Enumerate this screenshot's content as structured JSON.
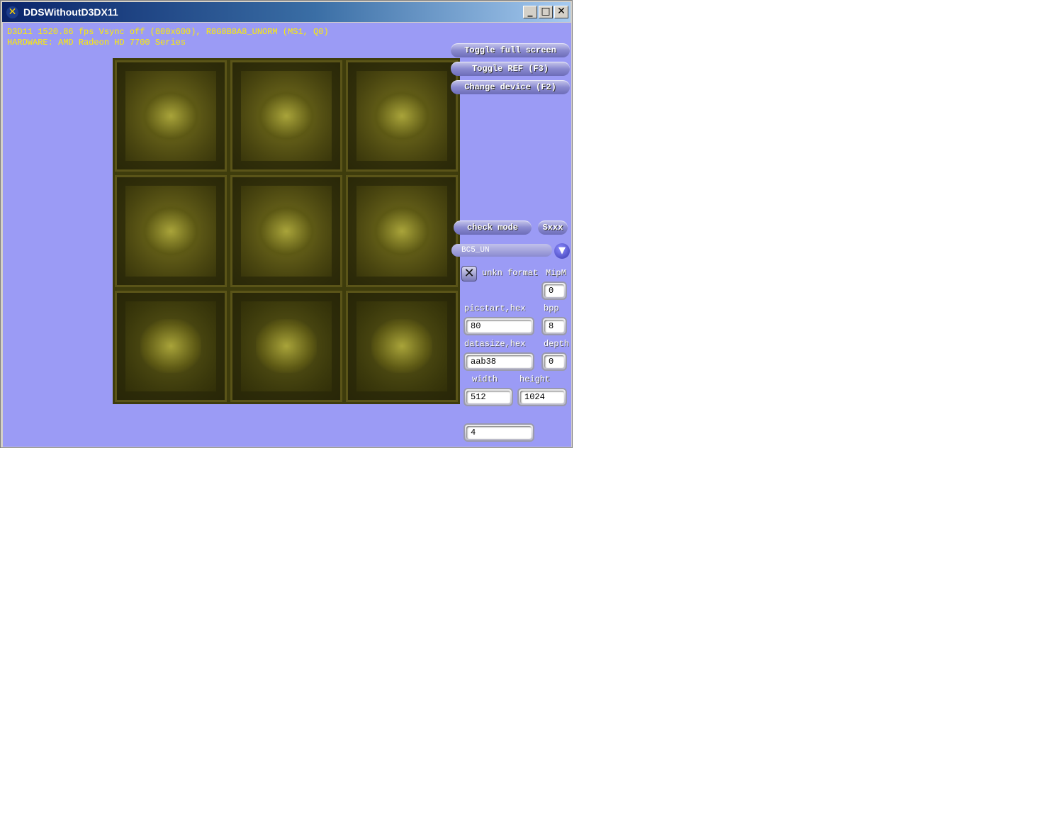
{
  "window": {
    "title": "DDSWithoutD3DX11",
    "minimize_glyph": "_",
    "maximize_glyph": "□",
    "close_glyph": "✕",
    "app_icon_glyph": "✕"
  },
  "stats": {
    "line1": "D3D11 1520.86 fps Vsync off (800x600), R8G8B8A8_UNORM (MS1, Q0)",
    "line2": "HARDWARE: AMD Radeon HD 7700 Series",
    "color": "#ffee00"
  },
  "buttons": {
    "toggle_full_screen": "Toggle full screen",
    "toggle_ref": "Toggle REF (F3)",
    "change_device": "Change device (F2)",
    "check_mode": "check mode",
    "sxxx": "Sxxx"
  },
  "format_combo": {
    "selected": "BC5_UN",
    "arrow_glyph": "▼"
  },
  "checkbox": {
    "checked": true,
    "glyph": "✕",
    "label": "unkn format"
  },
  "labels": {
    "mipm": "MipM",
    "picstart_hex": "picstart,hex",
    "bpp": "bpp",
    "datasize_hex": "datasize,hex",
    "depth": "depth",
    "width": "width",
    "height": "height"
  },
  "fields": {
    "mipm": "0",
    "picstart_hex": "80",
    "bpp": "8",
    "datasize_hex": "aab38",
    "depth": "0",
    "width": "512",
    "height": "1024",
    "extra": "4"
  },
  "colors": {
    "client_background": "#9b9bf5",
    "texture_tint": "#5a5418"
  }
}
